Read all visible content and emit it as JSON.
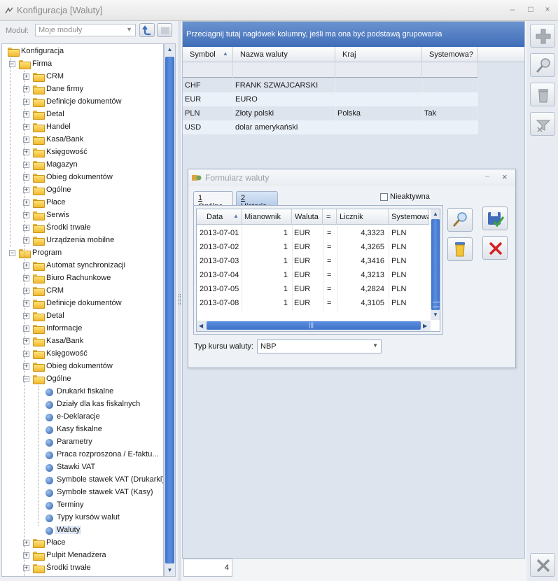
{
  "window": {
    "title": "Konfiguracja [Waluty]",
    "min": "–",
    "max": "□",
    "close": "×"
  },
  "module": {
    "label": "Moduł:",
    "value": "Moje moduły"
  },
  "tree": [
    {
      "label": "Konfiguracja",
      "level": 0,
      "type": "folder",
      "exp": ""
    },
    {
      "label": "Firma",
      "level": 1,
      "type": "folder",
      "exp": "-"
    },
    {
      "label": "CRM",
      "level": 2,
      "type": "folder",
      "exp": "+"
    },
    {
      "label": "Dane firmy",
      "level": 2,
      "type": "folder",
      "exp": "+"
    },
    {
      "label": "Definicje dokumentów",
      "level": 2,
      "type": "folder",
      "exp": "+"
    },
    {
      "label": "Detal",
      "level": 2,
      "type": "folder",
      "exp": "+"
    },
    {
      "label": "Handel",
      "level": 2,
      "type": "folder",
      "exp": "+"
    },
    {
      "label": "Kasa/Bank",
      "level": 2,
      "type": "folder",
      "exp": "+"
    },
    {
      "label": "Księgowość",
      "level": 2,
      "type": "folder",
      "exp": "+"
    },
    {
      "label": "Magazyn",
      "level": 2,
      "type": "folder",
      "exp": "+"
    },
    {
      "label": "Obieg dokumentów",
      "level": 2,
      "type": "folder",
      "exp": "+"
    },
    {
      "label": "Ogólne",
      "level": 2,
      "type": "folder",
      "exp": "+"
    },
    {
      "label": "Płace",
      "level": 2,
      "type": "folder",
      "exp": "+"
    },
    {
      "label": "Serwis",
      "level": 2,
      "type": "folder",
      "exp": "+"
    },
    {
      "label": "Środki trwałe",
      "level": 2,
      "type": "folder",
      "exp": "+"
    },
    {
      "label": "Urządzenia mobilne",
      "level": 2,
      "type": "folder",
      "exp": "+"
    },
    {
      "label": "Program",
      "level": 1,
      "type": "folder",
      "exp": "-"
    },
    {
      "label": "Automat synchronizacji",
      "level": 2,
      "type": "folder",
      "exp": "+"
    },
    {
      "label": "Biuro Rachunkowe",
      "level": 2,
      "type": "folder",
      "exp": "+"
    },
    {
      "label": "CRM",
      "level": 2,
      "type": "folder",
      "exp": "+"
    },
    {
      "label": "Definicje dokumentów",
      "level": 2,
      "type": "folder",
      "exp": "+"
    },
    {
      "label": "Detal",
      "level": 2,
      "type": "folder",
      "exp": "+"
    },
    {
      "label": "Informacje",
      "level": 2,
      "type": "folder",
      "exp": "+"
    },
    {
      "label": "Kasa/Bank",
      "level": 2,
      "type": "folder",
      "exp": "+"
    },
    {
      "label": "Księgowość",
      "level": 2,
      "type": "folder",
      "exp": "+"
    },
    {
      "label": "Obieg dokumentów",
      "level": 2,
      "type": "folder",
      "exp": "+"
    },
    {
      "label": "Ogólne",
      "level": 2,
      "type": "folder",
      "exp": "-"
    },
    {
      "label": "Drukarki fiskalne",
      "level": 3,
      "type": "leaf",
      "exp": ""
    },
    {
      "label": "Działy dla kas fiskalnych",
      "level": 3,
      "type": "leaf",
      "exp": ""
    },
    {
      "label": "e-Deklaracje",
      "level": 3,
      "type": "leaf",
      "exp": ""
    },
    {
      "label": "Kasy fiskalne",
      "level": 3,
      "type": "leaf",
      "exp": ""
    },
    {
      "label": "Parametry",
      "level": 3,
      "type": "leaf",
      "exp": ""
    },
    {
      "label": "Praca rozproszona / E-faktu...",
      "level": 3,
      "type": "leaf",
      "exp": ""
    },
    {
      "label": "Stawki VAT",
      "level": 3,
      "type": "leaf",
      "exp": ""
    },
    {
      "label": "Symbole stawek VAT (Drukarki)",
      "level": 3,
      "type": "leaf",
      "exp": ""
    },
    {
      "label": "Symbole stawek VAT (Kasy)",
      "level": 3,
      "type": "leaf",
      "exp": ""
    },
    {
      "label": "Terminy",
      "level": 3,
      "type": "leaf",
      "exp": ""
    },
    {
      "label": "Typy kursów walut",
      "level": 3,
      "type": "leaf",
      "exp": ""
    },
    {
      "label": "Waluty",
      "level": 3,
      "type": "leaf",
      "exp": "",
      "selected": true
    },
    {
      "label": "Płace",
      "level": 2,
      "type": "folder",
      "exp": "+"
    },
    {
      "label": "Pulpit Menadżera",
      "level": 2,
      "type": "folder",
      "exp": "+"
    },
    {
      "label": "Środki trwałe",
      "level": 2,
      "type": "folder",
      "exp": "+"
    }
  ],
  "grid": {
    "group_hint": "Przeciągnij tutaj nagłówek kolumny, jeśli ma ona być podstawą grupowania",
    "columns": [
      "Symbol",
      "Nazwa waluty",
      "Kraj",
      "Systemowa?"
    ],
    "rows": [
      [
        "CHF",
        "FRANK SZWAJCARSKI",
        "",
        ""
      ],
      [
        "EUR",
        "EURO",
        "",
        ""
      ],
      [
        "PLN",
        "Złoty polski",
        "Polska",
        "Tak"
      ],
      [
        "USD",
        "dolar amerykański",
        "",
        ""
      ]
    ],
    "count": "4"
  },
  "dialog": {
    "title": "Formularz waluty",
    "min": "–",
    "close": "×",
    "tabs": [
      {
        "key": "1",
        "label": " Ogólne"
      },
      {
        "key": "2",
        "label": " Historia"
      }
    ],
    "inactive_label": "Nieaktywna",
    "history": {
      "columns": [
        "Data",
        "Mianownik",
        "Waluta",
        "=",
        "Licznik",
        "Systemowa"
      ],
      "rows": [
        [
          "2013-07-01",
          "1",
          "EUR",
          "=",
          "4,3323",
          "PLN"
        ],
        [
          "2013-07-02",
          "1",
          "EUR",
          "=",
          "4,3265",
          "PLN"
        ],
        [
          "2013-07-03",
          "1",
          "EUR",
          "=",
          "4,3416",
          "PLN"
        ],
        [
          "2013-07-04",
          "1",
          "EUR",
          "=",
          "4,3213",
          "PLN"
        ],
        [
          "2013-07-05",
          "1",
          "EUR",
          "=",
          "4,2824",
          "PLN"
        ],
        [
          "2013-07-08",
          "1",
          "EUR",
          "=",
          "4,3105",
          "PLN"
        ]
      ]
    },
    "rate_type_label": "Typ kursu waluty:",
    "rate_type_value": "NBP"
  },
  "glyphs": {
    "sort_up": "▲",
    "dropdown": "▼",
    "left": "◀",
    "right": "▶",
    "up": "▲",
    "down": "▼",
    "hgrip": "|||"
  },
  "colors": {
    "accent": "#3f6db8",
    "selection": "#dfe8f5",
    "folder": "#f0b92e"
  }
}
